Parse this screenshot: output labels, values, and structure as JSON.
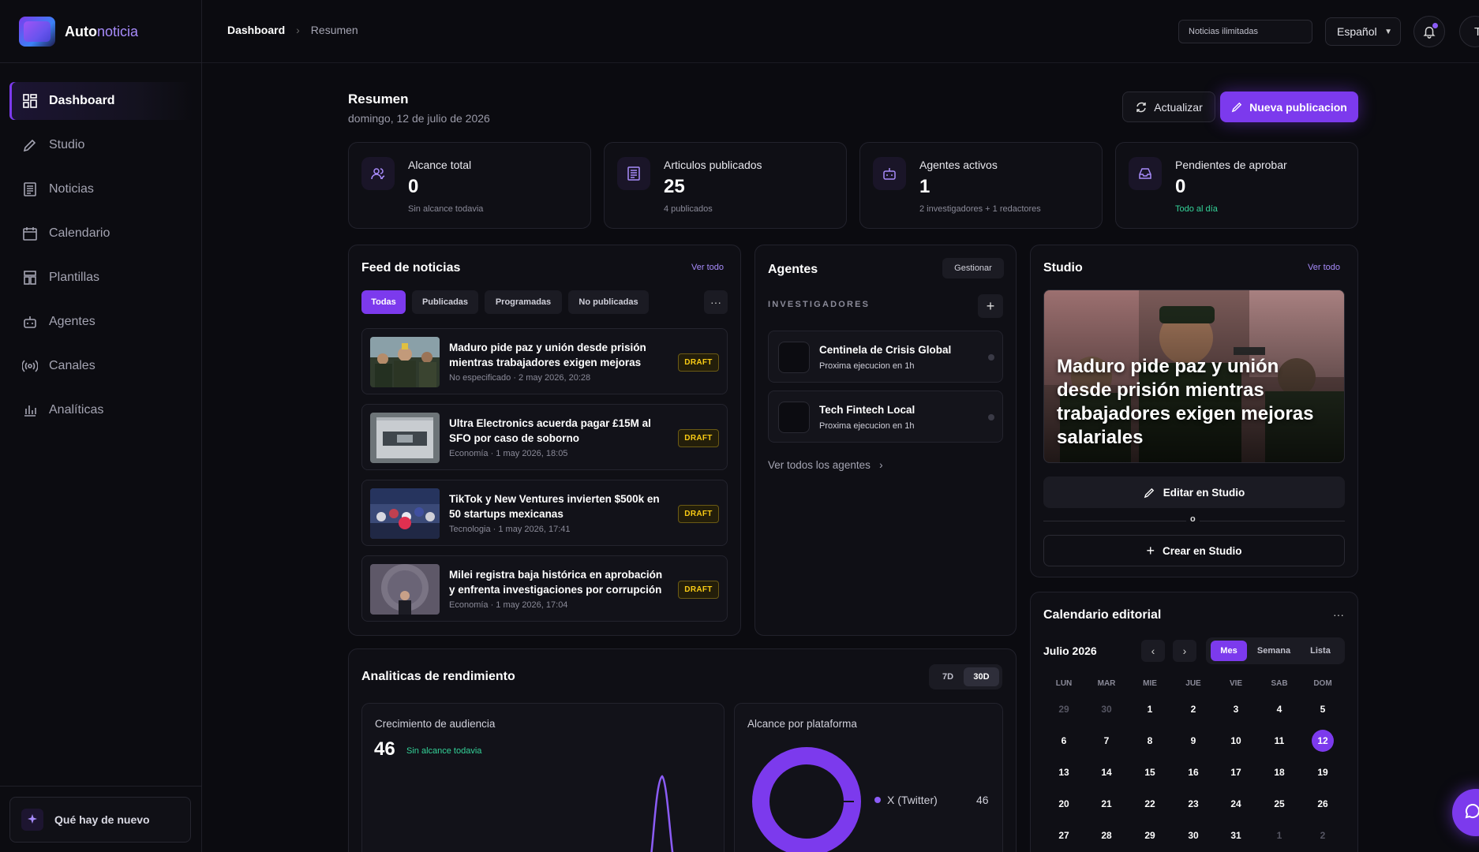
{
  "brand": {
    "name_bold": "Auto",
    "name_light": "noticia"
  },
  "sidebar": {
    "items": [
      {
        "label": "Dashboard",
        "icon": "dashboard-icon",
        "active": true
      },
      {
        "label": "Studio",
        "icon": "pencil-icon"
      },
      {
        "label": "Noticias",
        "icon": "newspaper-icon"
      },
      {
        "label": "Calendario",
        "icon": "calendar-icon"
      },
      {
        "label": "Plantillas",
        "icon": "template-icon"
      },
      {
        "label": "Agentes",
        "icon": "bot-icon"
      },
      {
        "label": "Canales",
        "icon": "broadcast-icon"
      },
      {
        "label": "Analíticas",
        "icon": "bar-chart-icon"
      }
    ],
    "whats_new": "Qué hay de nuevo"
  },
  "topbar": {
    "breadcrumb": [
      "Dashboard",
      "Resumen"
    ],
    "plan_input_value": "Noticias ilimitadas",
    "language": "Español",
    "avatar_initial": "T"
  },
  "header": {
    "title": "Resumen",
    "date": "domingo, 12 de julio de 2026",
    "refresh_label": "Actualizar",
    "new_post_label": "Nueva publicacion"
  },
  "stats": [
    {
      "label": "Alcance total",
      "value": "0",
      "sub": "Sin alcance todavia",
      "icon": "users-icon"
    },
    {
      "label": "Articulos publicados",
      "value": "25",
      "sub": "4 publicados",
      "icon": "newspaper-icon"
    },
    {
      "label": "Agentes activos",
      "value": "1",
      "sub": "2 investigadores + 1 redactores",
      "icon": "bot-icon"
    },
    {
      "label": "Pendientes de aprobar",
      "value": "0",
      "sub": "Todo al día",
      "icon": "inbox-icon"
    }
  ],
  "feed": {
    "title": "Feed de noticias",
    "see_all": "Ver todo",
    "tabs": [
      "Todas",
      "Publicadas",
      "Programadas",
      "No publicadas"
    ],
    "items": [
      {
        "title": "Maduro pide paz y unión desde prisión mientras trabajadores exigen mejoras salariales",
        "meta": "No especificado · 2 may 2026, 20:28",
        "status": "DRAFT"
      },
      {
        "title": "Ultra Electronics acuerda pagar £15M al SFO por caso de soborno",
        "meta": "Economía · 1 may 2026, 18:05",
        "status": "DRAFT"
      },
      {
        "title": "TikTok y New Ventures invierten $500k en 50 startups mexicanas",
        "meta": "Tecnologia · 1 may 2026, 17:41",
        "status": "DRAFT"
      },
      {
        "title": "Milei registra baja histórica en aprobación y enfrenta investigaciones por corrupción",
        "meta": "Economía · 1 may 2026, 17:04",
        "status": "DRAFT"
      }
    ]
  },
  "agents": {
    "title": "Agentes",
    "manage": "Gestionar",
    "section": "INVESTIGADORES",
    "items": [
      {
        "name": "Centinela de Crisis Global",
        "status": "Proxima ejecucion en 1h"
      },
      {
        "name": "Tech Fintech Local",
        "status": "Proxima ejecucion en 1h"
      }
    ],
    "see_all": "Ver todos los agentes"
  },
  "studio": {
    "title": "Studio",
    "see_all": "Ver todo",
    "hero_title": "Maduro pide paz y unión desde prisión mientras trabajadores exigen mejoras salariales",
    "edit_label": "Editar en Studio",
    "divider_text": "o",
    "create_label": "Crear en Studio"
  },
  "calendar": {
    "title": "Calendario editorial",
    "month": "Julio 2026",
    "views": [
      "Mes",
      "Semana",
      "Lista"
    ],
    "weekdays": [
      "LUN",
      "MAR",
      "MIE",
      "JUE",
      "VIE",
      "SAB",
      "DOM"
    ],
    "weeks": [
      [
        "29",
        "30",
        "1",
        "2",
        "3",
        "4",
        "5"
      ],
      [
        "6",
        "7",
        "8",
        "9",
        "10",
        "11",
        "12"
      ],
      [
        "13",
        "14",
        "15",
        "16",
        "17",
        "18",
        "19"
      ],
      [
        "20",
        "21",
        "22",
        "23",
        "24",
        "25",
        "26"
      ],
      [
        "27",
        "28",
        "29",
        "30",
        "31",
        "1",
        "2"
      ]
    ],
    "today": "12"
  },
  "analytics": {
    "title": "Analiticas de rendimiento",
    "ranges": [
      "7D",
      "30D"
    ],
    "active_range": "30D",
    "audience": {
      "title": "Crecimiento de audiencia",
      "value": "46",
      "note": "Sin alcance todavia"
    },
    "platform": {
      "title": "Alcance por plataforma",
      "legend": "X (Twitter)",
      "value": "46"
    }
  },
  "colors": {
    "accent": "#7c3aed",
    "success": "#34d399",
    "draft": "#facc15",
    "bg": "#0b0b10"
  }
}
